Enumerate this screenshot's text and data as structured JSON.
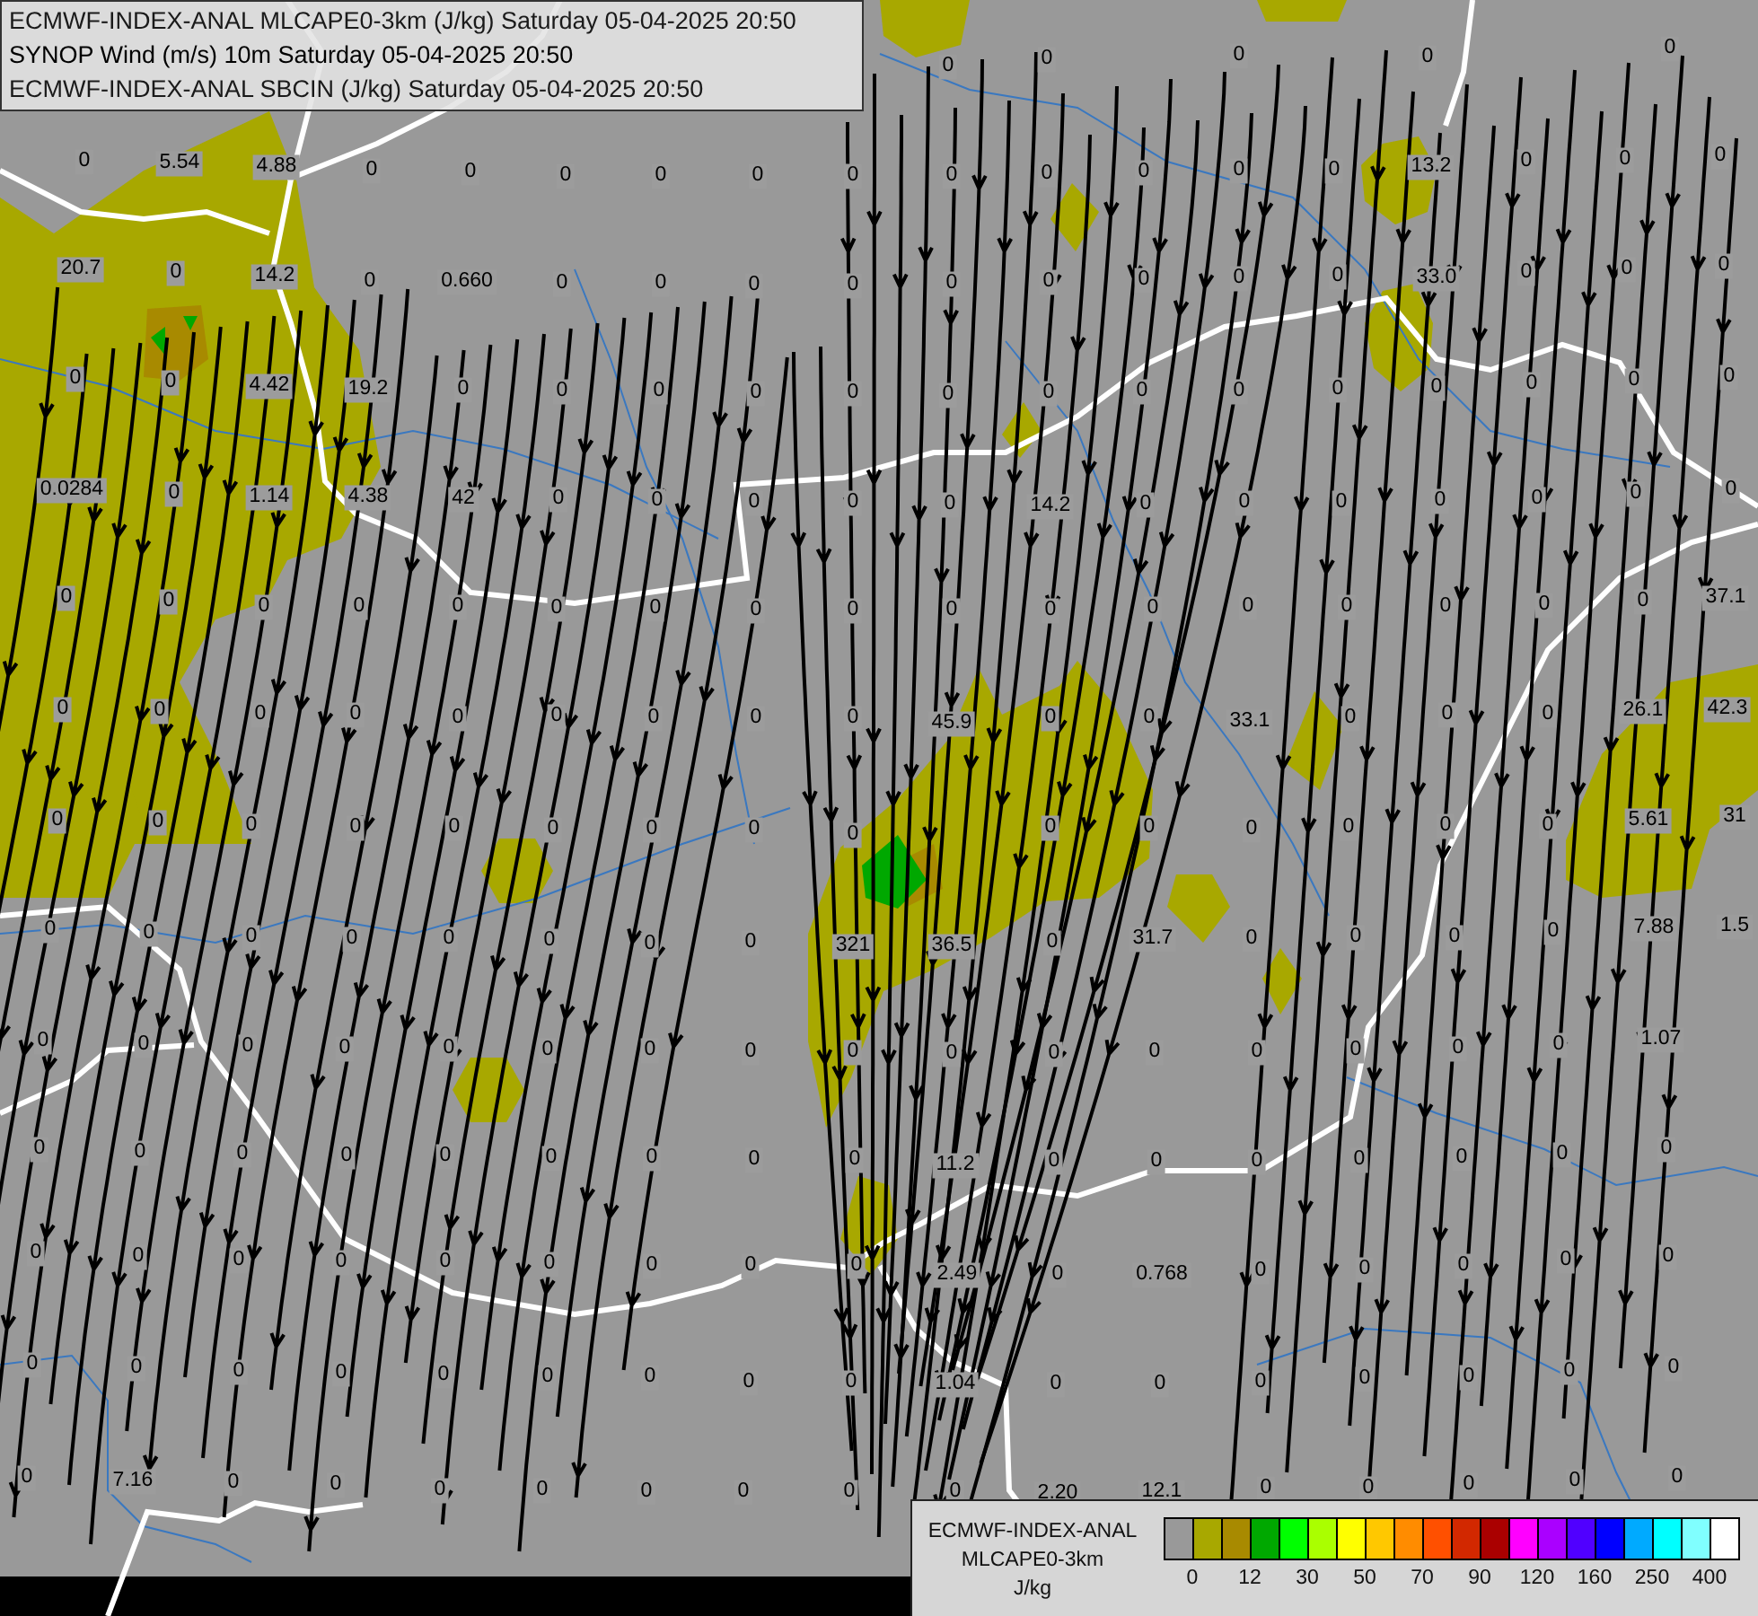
{
  "header": {
    "lines": [
      "ECMWF-INDEX-ANAL MLCAPE0-3km (J/kg) Saturday 05-04-2025 20:50",
      "SYNOP Wind (m/s) 10m Saturday 05-04-2025 20:50",
      "ECMWF-INDEX-ANAL SBCIN (J/kg) Saturday 05-04-2025 20:50"
    ]
  },
  "station_values": [
    [
      "0",
      "0",
      "0",
      "0",
      "0"
    ],
    [
      "0",
      "5.54",
      "4.88",
      "0",
      "0",
      "0",
      "0",
      "0",
      "0",
      "0",
      "0",
      "0",
      "0",
      "0",
      "13.2",
      "0",
      "0",
      "0"
    ],
    [
      "20.7",
      "0",
      "14.2",
      "0",
      "0.660",
      "0",
      "0",
      "0",
      "0",
      "0",
      "0",
      "0",
      "0",
      "0",
      "33.0",
      "0",
      "0",
      "0"
    ],
    [
      "0",
      "0",
      "4.42",
      "19.2",
      "0",
      "0",
      "0",
      "0",
      "0",
      "0",
      "0",
      "0",
      "0",
      "0",
      "0",
      "0",
      "0",
      "0"
    ],
    [
      "0.0284",
      "0",
      "1.14",
      "4.38",
      "42",
      "0",
      "0",
      "0",
      "0",
      "0",
      "14.2",
      "0",
      "0",
      "0",
      "0",
      "0",
      "0",
      "0"
    ],
    [
      "0",
      "0",
      "0",
      "0",
      "0",
      "0",
      "0",
      "0",
      "0",
      "0",
      "0",
      "0",
      "0",
      "0",
      "0",
      "0",
      "0",
      "37.1"
    ],
    [
      "0",
      "0",
      "0",
      "0",
      "0",
      "0",
      "0",
      "0",
      "0",
      "45.9",
      "0",
      "0",
      "33.1",
      "0",
      "0",
      "0",
      "26.1",
      "42.3"
    ],
    [
      "0",
      "0",
      "0",
      "0",
      "0",
      "0",
      "0",
      "0",
      "0",
      "0",
      "0",
      "0",
      "0",
      "0",
      "0",
      "5.61",
      "31"
    ],
    [
      "0",
      "0",
      "0",
      "0",
      "0",
      "0",
      "0",
      "0",
      "321",
      "36.5",
      "0",
      "31.7",
      "0",
      "0",
      "0",
      "0",
      "7.88",
      "1.5"
    ],
    [
      "0",
      "0",
      "0",
      "0",
      "0",
      "0",
      "0",
      "0",
      "0",
      "0",
      "0",
      "0",
      "0",
      "0",
      "0",
      "0",
      "1.07"
    ],
    [
      "0",
      "0",
      "0",
      "0",
      "0",
      "0",
      "0",
      "0",
      "0",
      "11.2",
      "0",
      "0",
      "0",
      "0",
      "0",
      "0",
      "0"
    ],
    [
      "0",
      "0",
      "0",
      "0",
      "0",
      "0",
      "0",
      "0",
      "0",
      "2.49",
      "0",
      "0.768",
      "0",
      "0",
      "0",
      "0",
      "0"
    ],
    [
      "0",
      "0",
      "0",
      "0",
      "0",
      "0",
      "0",
      "0",
      "0",
      "1.04",
      "0",
      "0",
      "0",
      "0",
      "0",
      "0",
      "0"
    ],
    [
      "0",
      "7.16",
      "0",
      "0",
      "0",
      "0",
      "0",
      "0",
      "0",
      "0",
      "2.20",
      "12.1",
      "0",
      "0",
      "0",
      "0",
      "0"
    ]
  ],
  "legend": {
    "title_lines": [
      "ECMWF-INDEX-ANAL",
      "MLCAPE0-3km"
    ],
    "unit": "J/kg",
    "swatches": [
      {
        "color": "#999999"
      },
      {
        "color": "#a8a800"
      },
      {
        "color": "#a88a00"
      },
      {
        "color": "#00a800"
      },
      {
        "color": "#00ff00"
      },
      {
        "color": "#aaff00"
      },
      {
        "color": "#ffff00"
      },
      {
        "color": "#ffc800"
      },
      {
        "color": "#ff8c00"
      },
      {
        "color": "#ff5000"
      },
      {
        "color": "#d22800"
      },
      {
        "color": "#aa0000"
      },
      {
        "color": "#ff00ff"
      },
      {
        "color": "#aa00ff"
      },
      {
        "color": "#5000ff"
      },
      {
        "color": "#0000ff"
      },
      {
        "color": "#00aaff"
      },
      {
        "color": "#00ffff"
      },
      {
        "color": "#80ffff"
      },
      {
        "color": "#ffffff"
      }
    ],
    "ticks": [
      "0",
      "12",
      "30",
      "50",
      "70",
      "90",
      "120",
      "160",
      "250",
      "400"
    ]
  }
}
